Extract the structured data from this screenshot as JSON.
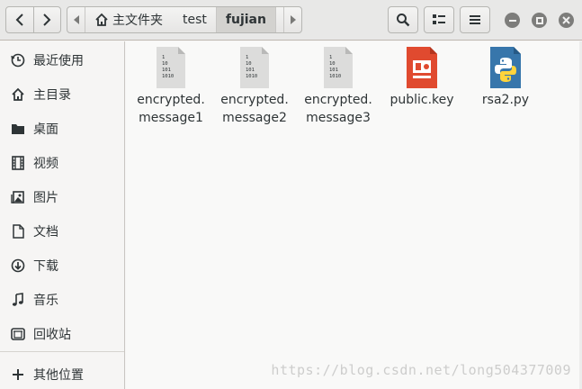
{
  "header": {
    "path": {
      "home_label": "主文件夹",
      "crumbs": [
        "test",
        "fujian"
      ]
    },
    "icons": {
      "back": "chevron-left-icon",
      "forward": "chevron-right-icon",
      "search": "search-icon",
      "view": "grid-view-icon",
      "menu": "hamburger-menu-icon",
      "minimize": "minimize-icon",
      "maximize": "maximize-icon",
      "close": "close-icon"
    }
  },
  "sidebar": {
    "items": [
      {
        "label": "最近使用",
        "icon": "clock-icon"
      },
      {
        "label": "主目录",
        "icon": "home-icon"
      },
      {
        "label": "桌面",
        "icon": "folder-icon"
      },
      {
        "label": "视频",
        "icon": "film-icon"
      },
      {
        "label": "图片",
        "icon": "image-icon"
      },
      {
        "label": "文档",
        "icon": "document-icon"
      },
      {
        "label": "下载",
        "icon": "download-icon"
      },
      {
        "label": "音乐",
        "icon": "music-icon"
      },
      {
        "label": "回收站",
        "icon": "trash-icon"
      },
      {
        "label": "其他位置",
        "icon": "plus-icon"
      }
    ]
  },
  "files": [
    {
      "line1": "encrypted.",
      "line2": "message1",
      "icon": "binary-file-icon"
    },
    {
      "line1": "encrypted.",
      "line2": "message2",
      "icon": "binary-file-icon"
    },
    {
      "line1": "encrypted.",
      "line2": "message3",
      "icon": "binary-file-icon"
    },
    {
      "line1": "public.key",
      "line2": "",
      "icon": "presentation-file-icon"
    },
    {
      "line1": "rsa2.py",
      "line2": "",
      "icon": "python-file-icon"
    }
  ],
  "binary_icon_text": [
    "1",
    "10",
    "101",
    "1010"
  ],
  "watermark": "https://blog.csdn.net/long504377009",
  "colors": {
    "accent_key": "#e04a2f",
    "python_blue": "#3776ab",
    "selected_crumb": "#d3d2cf"
  }
}
